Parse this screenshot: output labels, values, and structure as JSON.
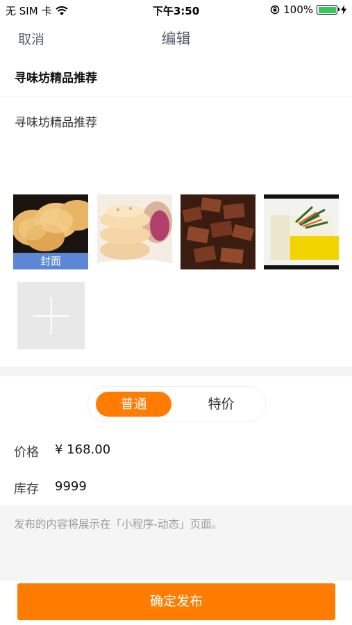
{
  "status_bar": {
    "carrier": "无 SIM 卡",
    "time": "下午3:50",
    "battery_pct": "100%",
    "battery_level": 1.0,
    "wifi_icon": "wifi-icon",
    "lock_icon": "orientation-lock-icon",
    "charging_icon": "charging-bolt-icon"
  },
  "nav": {
    "cancel": "取消",
    "title": "编辑"
  },
  "post": {
    "title": "寻味坊精品推荐",
    "content": "寻味坊精品推荐"
  },
  "photos": {
    "cover_label": "封面",
    "items": [
      {
        "name": "photo-sesame-pastry",
        "is_cover": true
      },
      {
        "name": "photo-flower-pastry",
        "is_cover": false
      },
      {
        "name": "photo-dried-tofu",
        "is_cover": false
      },
      {
        "name": "photo-tofu-dish",
        "is_cover": false
      }
    ],
    "add_icon": "plus-icon"
  },
  "type_segment": {
    "options": [
      "普通",
      "特价"
    ],
    "selected": "普通"
  },
  "price": {
    "label": "价格",
    "value": "¥ 168.00"
  },
  "stock": {
    "label": "库存",
    "value": "9999"
  },
  "notice": "发布的内容将展示在「小程序-动态」页面。",
  "submit": "确定发布",
  "colors": {
    "accent": "#ff7c00",
    "cover_label_bg": "#5c86d6",
    "battery_green": "#34c759"
  }
}
